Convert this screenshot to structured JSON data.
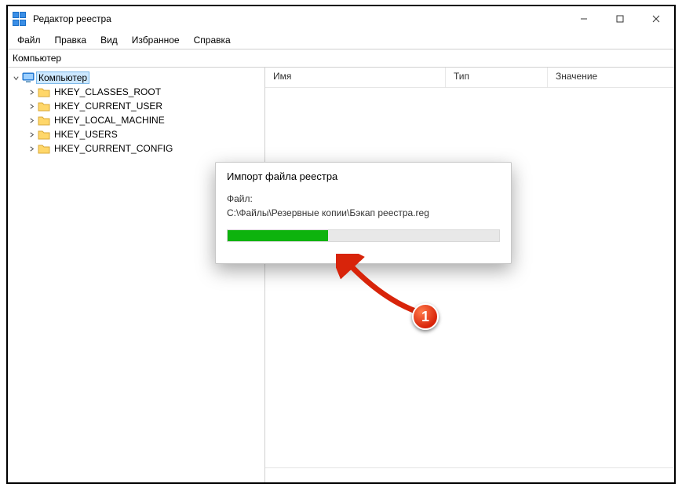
{
  "window": {
    "title": "Редактор реестра"
  },
  "menu": {
    "file": "Файл",
    "edit": "Правка",
    "view": "Вид",
    "favorites": "Избранное",
    "help": "Справка"
  },
  "addressbar": {
    "path": "Компьютер"
  },
  "tree": {
    "root": "Компьютер",
    "items": [
      "HKEY_CLASSES_ROOT",
      "HKEY_CURRENT_USER",
      "HKEY_LOCAL_MACHINE",
      "HKEY_USERS",
      "HKEY_CURRENT_CONFIG"
    ]
  },
  "columns": {
    "name": "Имя",
    "type": "Тип",
    "value": "Значение"
  },
  "dialog": {
    "title": "Импорт файла реестра",
    "file_label": "Файл:",
    "file_path": "C:\\Файлы\\Резервные копии\\Бэкап реестра.reg",
    "progress_percent": 37
  },
  "annotation": {
    "badge": "1"
  }
}
